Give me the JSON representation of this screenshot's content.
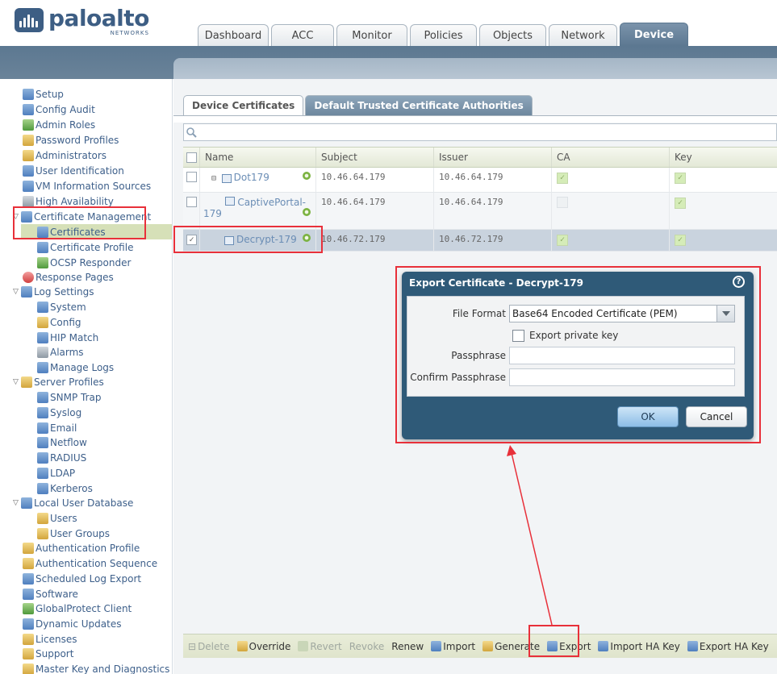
{
  "logo": {
    "word": "paloalto",
    "sub": "NETWORKS"
  },
  "tabs": [
    {
      "label": "Dashboard",
      "active": false
    },
    {
      "label": "ACC",
      "active": false
    },
    {
      "label": "Monitor",
      "active": false
    },
    {
      "label": "Policies",
      "active": false
    },
    {
      "label": "Objects",
      "active": false
    },
    {
      "label": "Network",
      "active": false
    },
    {
      "label": "Device",
      "active": true
    }
  ],
  "sidebar": {
    "items": [
      {
        "label": "Setup",
        "icon": "setup-icon"
      },
      {
        "label": "Config Audit",
        "icon": "config-audit-icon"
      },
      {
        "label": "Admin Roles",
        "icon": "admin-roles-icon"
      },
      {
        "label": "Password Profiles",
        "icon": "password-profiles-icon"
      },
      {
        "label": "Administrators",
        "icon": "administrators-icon"
      },
      {
        "label": "User Identification",
        "icon": "user-identification-icon"
      },
      {
        "label": "VM Information Sources",
        "icon": "vm-information-icon"
      },
      {
        "label": "High Availability",
        "icon": "high-availability-icon"
      },
      {
        "label": "Certificate Management",
        "icon": "certificate-management-icon"
      },
      {
        "label": "Certificates",
        "icon": "certificates-icon"
      },
      {
        "label": "Certificate Profile",
        "icon": "certificate-profile-icon"
      },
      {
        "label": "OCSP Responder",
        "icon": "ocsp-responder-icon"
      },
      {
        "label": "Response Pages",
        "icon": "response-pages-icon"
      },
      {
        "label": "Log Settings",
        "icon": "log-settings-icon"
      },
      {
        "label": "System",
        "icon": "system-icon"
      },
      {
        "label": "Config",
        "icon": "config-icon"
      },
      {
        "label": "HIP Match",
        "icon": "hip-match-icon"
      },
      {
        "label": "Alarms",
        "icon": "alarms-icon"
      },
      {
        "label": "Manage Logs",
        "icon": "manage-logs-icon"
      },
      {
        "label": "Server Profiles",
        "icon": "server-profiles-icon"
      },
      {
        "label": "SNMP Trap",
        "icon": "snmp-trap-icon"
      },
      {
        "label": "Syslog",
        "icon": "syslog-icon"
      },
      {
        "label": "Email",
        "icon": "email-icon"
      },
      {
        "label": "Netflow",
        "icon": "netflow-icon"
      },
      {
        "label": "RADIUS",
        "icon": "radius-icon"
      },
      {
        "label": "LDAP",
        "icon": "ldap-icon"
      },
      {
        "label": "Kerberos",
        "icon": "kerberos-icon"
      },
      {
        "label": "Local User Database",
        "icon": "local-user-database-icon"
      },
      {
        "label": "Users",
        "icon": "users-icon"
      },
      {
        "label": "User Groups",
        "icon": "user-groups-icon"
      },
      {
        "label": "Authentication Profile",
        "icon": "authentication-profile-icon"
      },
      {
        "label": "Authentication Sequence",
        "icon": "authentication-sequence-icon"
      },
      {
        "label": "Scheduled Log Export",
        "icon": "scheduled-log-export-icon"
      },
      {
        "label": "Software",
        "icon": "software-icon"
      },
      {
        "label": "GlobalProtect Client",
        "icon": "globalprotect-client-icon"
      },
      {
        "label": "Dynamic Updates",
        "icon": "dynamic-updates-icon"
      },
      {
        "label": "Licenses",
        "icon": "licenses-icon"
      },
      {
        "label": "Support",
        "icon": "support-icon"
      },
      {
        "label": "Master Key and Diagnostics",
        "icon": "master-key-icon"
      }
    ]
  },
  "subtabs": [
    {
      "label": "Device Certificates",
      "active": true
    },
    {
      "label": "Default Trusted Certificate Authorities",
      "active": false
    }
  ],
  "grid": {
    "columns": [
      "Name",
      "Subject",
      "Issuer",
      "CA",
      "Key"
    ],
    "rows": [
      {
        "name": "Dot179",
        "subject": "10.46.64.179",
        "issuer": "10.46.64.179",
        "ca": true,
        "key": true
      },
      {
        "name_line1": "CaptivePortal-",
        "name_line2": "179",
        "subject": "10.46.64.179",
        "issuer": "10.46.64.179",
        "ca": false,
        "key": true
      },
      {
        "name": "Decrypt-179",
        "subject": "10.46.72.179",
        "issuer": "10.46.72.179",
        "ca": true,
        "key": true
      }
    ]
  },
  "toolbar": {
    "delete": "Delete",
    "override": "Override",
    "revert": "Revert",
    "revoke": "Revoke",
    "renew": "Renew",
    "import": "Import",
    "generate": "Generate",
    "export": "Export",
    "import_ha_key": "Import HA Key",
    "export_ha_key": "Export HA Key"
  },
  "dialog": {
    "title": "Export Certificate - Decrypt-179",
    "help": "?",
    "file_format_label": "File Format",
    "file_format_value": "Base64 Encoded Certificate (PEM)",
    "export_private_key_label": "Export private key",
    "passphrase_label": "Passphrase",
    "confirm_passphrase_label": "Confirm Passphrase",
    "ok_label": "OK",
    "cancel_label": "Cancel"
  }
}
